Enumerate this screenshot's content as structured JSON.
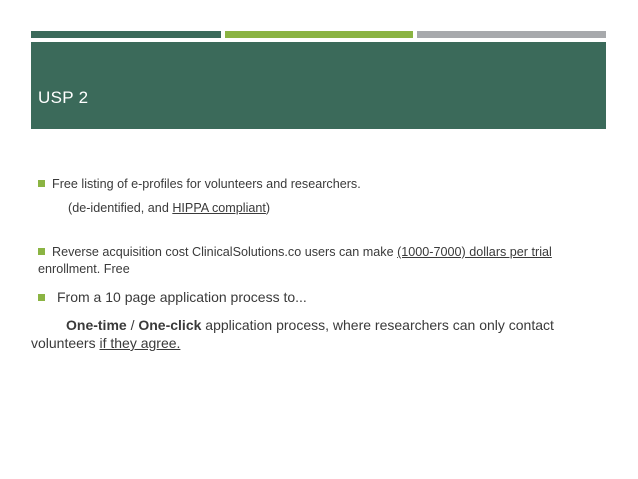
{
  "slide": {
    "title": "USP 2",
    "colors": {
      "primary": "#3b6a5a",
      "accent": "#8bb443",
      "gray": "#a7a9ac"
    }
  },
  "bullets": [
    {
      "text": "Free listing of e-profiles for volunteers and researchers.",
      "sub_prefix": "(de-identified, and ",
      "sub_link": "HIPPA compliant",
      "sub_suffix": ")"
    },
    {
      "line1_prefix": "Reverse acquisition cost ClinicalSolutions.co users can make ",
      "line1_link": "(1000-7000) dollars per trial",
      "line2": "enrollment.  Free"
    },
    {
      "text": "From a 10 page application process to...",
      "line2_bold1": "One-time",
      "line2_sep": " / ",
      "line2_bold2": "One-click",
      "line2_rest": " application process, where researchers can only contact",
      "line3_prefix": "volunteers ",
      "line3_link": "if they agree."
    }
  ]
}
